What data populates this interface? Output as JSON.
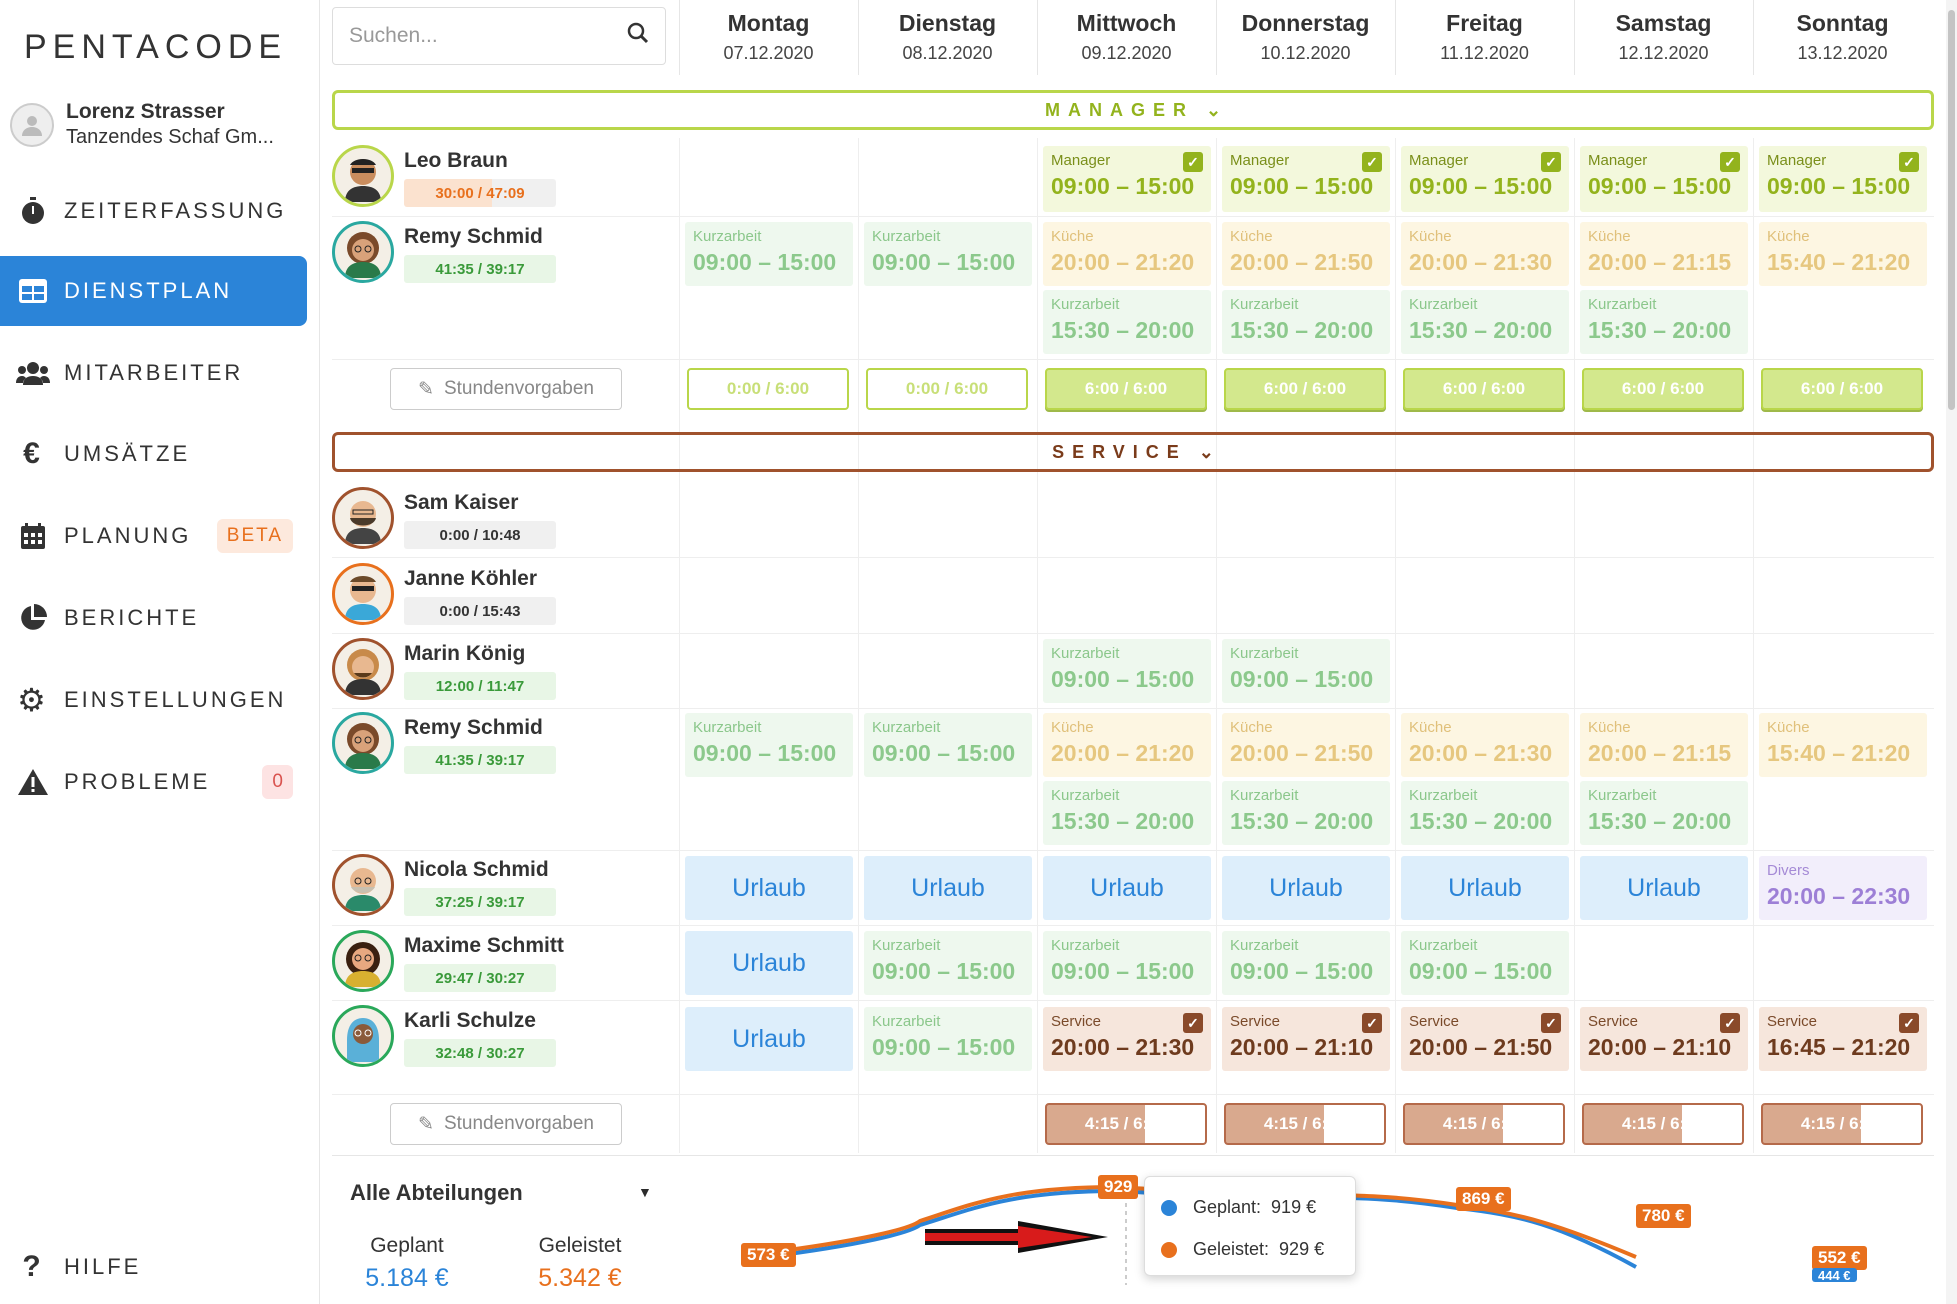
{
  "app": {
    "logo": "PENTACODE"
  },
  "user": {
    "name": "Lorenz Strasser",
    "company": "Tanzendes Schaf Gm..."
  },
  "nav": [
    {
      "label": "ZEITERFASSUNG",
      "icon": "stopwatch-icon",
      "active": false
    },
    {
      "label": "DIENSTPLAN",
      "icon": "grid-icon",
      "active": true
    },
    {
      "label": "MITARBEITER",
      "icon": "users-icon",
      "active": false
    },
    {
      "label": "UMSÄTZE",
      "icon": "euro-icon",
      "active": false
    },
    {
      "label": "PLANUNG",
      "icon": "calendar-icon",
      "active": false,
      "badge": "BETA"
    },
    {
      "label": "BERICHTE",
      "icon": "pie-chart-icon",
      "active": false
    },
    {
      "label": "EINSTELLUNGEN",
      "icon": "gear-icon",
      "active": false
    },
    {
      "label": "PROBLEME",
      "icon": "warning-icon",
      "active": false,
      "badge": "0"
    }
  ],
  "help": {
    "label": "HILFE",
    "icon": "question-icon"
  },
  "search": {
    "placeholder": "Suchen..."
  },
  "days": [
    {
      "name": "Montag",
      "date": "07.12.2020"
    },
    {
      "name": "Dienstag",
      "date": "08.12.2020"
    },
    {
      "name": "Mittwoch",
      "date": "09.12.2020"
    },
    {
      "name": "Donnerstag",
      "date": "10.12.2020"
    },
    {
      "name": "Freitag",
      "date": "11.12.2020"
    },
    {
      "name": "Samstag",
      "date": "12.12.2020"
    },
    {
      "name": "Sonntag",
      "date": "13.12.2020"
    }
  ],
  "sections": {
    "manager": "MANAGER",
    "service": "SERVICE"
  },
  "stundenvorgaben_label": "Stundenvorgaben",
  "manager_totals": [
    "0:00 / 6:00",
    "0:00 / 6:00",
    "6:00 / 6:00",
    "6:00 / 6:00",
    "6:00 / 6:00",
    "6:00 / 6:00",
    "6:00 / 6:00"
  ],
  "service_totals": [
    "4:15 / 6:00",
    "4:15 / 6:00",
    "4:15 / 6:00",
    "4:15 / 6:00",
    "4:15 / 6:00"
  ],
  "employees": {
    "leo": {
      "name": "Leo Braun",
      "hours": "30:00 / 47:09"
    },
    "remy1": {
      "name": "Remy Schmid",
      "hours": "41:35 / 39:17"
    },
    "sam": {
      "name": "Sam Kaiser",
      "hours": "0:00 / 10:48"
    },
    "janne": {
      "name": "Janne Köhler",
      "hours": "0:00 / 15:43"
    },
    "marin": {
      "name": "Marin König",
      "hours": "12:00 / 11:47"
    },
    "remy2": {
      "name": "Remy Schmid",
      "hours": "41:35 / 39:17"
    },
    "nicola": {
      "name": "Nicola Schmid",
      "hours": "37:25 / 39:17"
    },
    "maxime": {
      "name": "Maxime Schmitt",
      "hours": "29:47 / 30:27"
    },
    "karli": {
      "name": "Karli Schulze",
      "hours": "32:48 / 30:27"
    }
  },
  "shift_labels": {
    "manager": "Manager",
    "kurzarbeit": "Kurzarbeit",
    "kueche": "Küche",
    "service": "Service",
    "divers": "Divers",
    "urlaub": "Urlaub"
  },
  "times": {
    "t0915": "09:00 – 15:00",
    "t2021": "20:00 – 21:20",
    "t2050": "20:00 – 21:50",
    "t2030": "20:00 – 21:30",
    "t2015": "20:00 – 21:15",
    "t1540": "15:40 – 21:20",
    "t1530": "15:30 – 20:00",
    "t2022": "20:00 – 22:30",
    "s2130": "20:00 – 21:30",
    "s2110": "20:00 – 21:10",
    "s2150": "20:00 – 21:50",
    "s2111": "20:00 – 21:10",
    "s1645": "16:45 – 21:20"
  },
  "bottom": {
    "department": "Alle Abteilungen",
    "geplant_label": "Geplant",
    "geplant_value": "5.184 €",
    "geleistet_label": "Geleistet",
    "geleistet_value": "5.342 €"
  },
  "chart_data": {
    "type": "line",
    "series": [
      {
        "name": "Geplant",
        "color": "#2b84d8"
      },
      {
        "name": "Geleistet",
        "color": "#e8701d"
      }
    ],
    "tags": [
      "573 €",
      "929",
      "869 €",
      "780 €",
      "552 €",
      "444 €"
    ],
    "tooltip": {
      "geplant_label": "Geplant:",
      "geplant_value": "919 €",
      "geleistet_label": "Geleistet:",
      "geleistet_value": "929 €"
    }
  },
  "colors": {
    "accent": "#2b84d8",
    "manager": "#b9d64a",
    "service": "#a0522d",
    "orange": "#e8701d"
  }
}
